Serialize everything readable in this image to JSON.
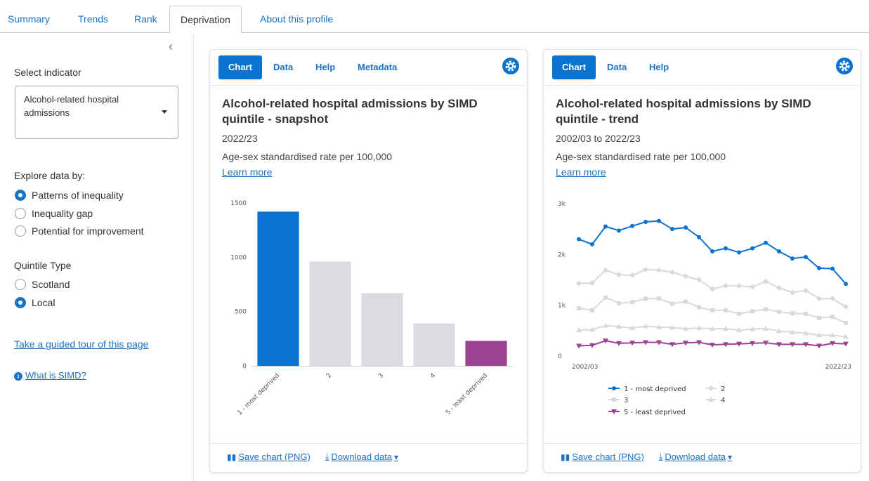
{
  "tabs": [
    "Summary",
    "Trends",
    "Rank",
    "Deprivation",
    "About this profile"
  ],
  "sidebar": {
    "select_label": "Select indicator",
    "indicator": "Alcohol-related hospital admissions",
    "explore_label": "Explore data by:",
    "explore_options": [
      "Patterns of inequality",
      "Inequality gap",
      "Potential for improvement"
    ],
    "explore_selected": "Patterns of inequality",
    "quintile_label": "Quintile Type",
    "quintile_options": [
      "Scotland",
      "Local"
    ],
    "quintile_selected": "Local",
    "tour_link": "Take a guided tour of this page",
    "simd_link": "What is SIMD?"
  },
  "cards": {
    "snapshot": {
      "tabs": [
        "Chart",
        "Data",
        "Help",
        "Metadata"
      ],
      "title": "Alcohol-related hospital admissions by SIMD quintile - snapshot",
      "period": "2022/23",
      "measure": "Age-sex standardised rate per 100,000",
      "learn_more": "Learn more",
      "save": "Save chart (PNG)",
      "download": "Download data"
    },
    "trend": {
      "tabs": [
        "Chart",
        "Data",
        "Help"
      ],
      "title": "Alcohol-related hospital admissions by SIMD quintile - trend",
      "period": "2002/03 to 2022/23",
      "measure": "Age-sex standardised rate per 100,000",
      "learn_more": "Learn more",
      "save": "Save chart (PNG)",
      "download": "Download data"
    }
  },
  "colors": {
    "accent": "#0a73d0",
    "most_deprived": "#0a73d0",
    "middle": "#dcdbe2",
    "least_deprived": "#9b4393"
  },
  "chart_data": [
    {
      "type": "bar",
      "categories": [
        "1 - most deprived",
        "2",
        "3",
        "4",
        "5 - least deprived"
      ],
      "values": [
        1420,
        960,
        670,
        390,
        230
      ],
      "ylim": [
        0,
        1500
      ],
      "yticks": [
        "0",
        "500",
        "1000",
        "1500"
      ],
      "grid": false,
      "colors": [
        "#0a73d0",
        "#dcdbe2",
        "#dcdbe2",
        "#dcdbe2",
        "#9b4393"
      ]
    },
    {
      "type": "line",
      "x_first": "2002/03",
      "x_last": "2022/23",
      "ylim": [
        0,
        3000
      ],
      "yticks": [
        "0",
        "1k",
        "2k",
        "3k"
      ],
      "legend_position": "bottom",
      "series": [
        {
          "name": "1 - most deprived",
          "color": "#0a73d0",
          "marker": "circle",
          "values": [
            2300,
            2200,
            2550,
            2470,
            2560,
            2640,
            2660,
            2500,
            2530,
            2340,
            2060,
            2120,
            2040,
            2120,
            2230,
            2060,
            1920,
            1950,
            1730,
            1720,
            1420
          ]
        },
        {
          "name": "2",
          "color": "#d9d9d9",
          "marker": "diamond",
          "values": [
            1430,
            1440,
            1690,
            1600,
            1590,
            1700,
            1690,
            1650,
            1570,
            1500,
            1320,
            1380,
            1380,
            1360,
            1470,
            1340,
            1250,
            1290,
            1130,
            1130,
            970
          ]
        },
        {
          "name": "3",
          "color": "#d9d9d9",
          "marker": "square",
          "values": [
            940,
            900,
            1150,
            1040,
            1060,
            1130,
            1130,
            1030,
            1070,
            960,
            900,
            900,
            830,
            880,
            920,
            870,
            840,
            830,
            750,
            770,
            650
          ]
        },
        {
          "name": "4",
          "color": "#d9d9d9",
          "marker": "triangle",
          "values": [
            510,
            520,
            600,
            580,
            550,
            590,
            570,
            560,
            540,
            550,
            540,
            540,
            510,
            530,
            540,
            490,
            470,
            450,
            410,
            410,
            380
          ]
        },
        {
          "name": "5 - least deprived",
          "color": "#9b4393",
          "marker": "triangle-down",
          "values": [
            200,
            210,
            300,
            250,
            260,
            270,
            270,
            230,
            260,
            270,
            220,
            230,
            240,
            250,
            260,
            230,
            230,
            230,
            200,
            250,
            240
          ]
        }
      ]
    }
  ]
}
